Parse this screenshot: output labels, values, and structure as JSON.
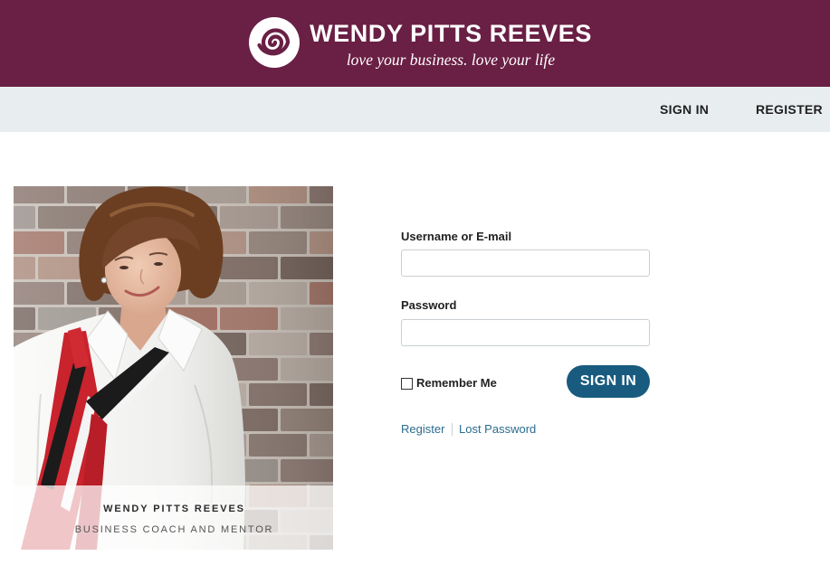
{
  "header": {
    "logo_icon": "swirl-icon",
    "brand_name": "WENDY PITTS REEVES",
    "tagline": "love your business. love your life"
  },
  "nav": {
    "items": [
      {
        "label": "SIGN IN"
      },
      {
        "label": "REGISTER"
      }
    ]
  },
  "profile": {
    "name": "WENDY PITTS REEVES",
    "title": "BUSINESS COACH AND MENTOR"
  },
  "login_form": {
    "username": {
      "label": "Username or E-mail",
      "value": ""
    },
    "password": {
      "label": "Password",
      "value": ""
    },
    "remember_me": {
      "label": "Remember Me",
      "checked": false
    },
    "submit_label": "SIGN IN",
    "links": [
      {
        "label": "Register"
      },
      {
        "label": "Lost Password"
      }
    ]
  },
  "colors": {
    "brand": "#6a1f44",
    "header_text": "#ffffff",
    "nav_background": "#e8eef0",
    "nav_text": "#1f1f1f",
    "button": "#185b7f",
    "button_text": "#ffffff",
    "link": "#2a6c8e"
  }
}
